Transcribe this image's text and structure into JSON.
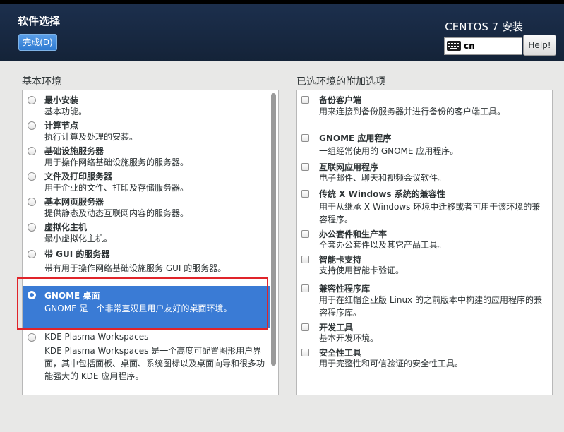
{
  "header": {
    "title": "软件选择",
    "done_button": "完成(D)",
    "install_title": "CENTOS 7 安装",
    "keyboard_layout": "cn",
    "help_button": "Help!"
  },
  "base_env": {
    "heading": "基本环境",
    "items": [
      {
        "name": "最小安装",
        "desc": "基本功能。"
      },
      {
        "name": "计算节点",
        "desc": "执行计算及处理的安装。"
      },
      {
        "name": "基础设施服务器",
        "desc": "用于操作网络基础设施服务的服务器。"
      },
      {
        "name": "文件及打印服务器",
        "desc": "用于企业的文件、打印及存储服务器。"
      },
      {
        "name": "基本网页服务器",
        "desc": "提供静态及动态互联网内容的服务器。"
      },
      {
        "name": "虚拟化主机",
        "desc": "最小虚拟化主机。"
      },
      {
        "name": "带 GUI 的服务器",
        "desc": "带有用于操作网络基础设施服务 GUI 的服务器。"
      },
      {
        "name": "GNOME 桌面",
        "desc": "GNOME 是一个非常直观且用户友好的桌面环境。",
        "selected": true
      },
      {
        "name": "KDE Plasma Workspaces",
        "desc": "KDE Plasma Workspaces 是一个高度可配置图形用户界面，其中包括面板、桌面、系统图标以及桌面向导和很多功能强大的 KDE 应用程序。"
      }
    ]
  },
  "addons": {
    "heading": "已选环境的附加选项",
    "items": [
      {
        "name": "备份客户端",
        "desc": "用来连接到备份服务器并进行备份的客户端工具。"
      },
      {
        "name": "GNOME 应用程序",
        "desc": "一组经常使用的 GNOME 应用程序。"
      },
      {
        "name": "互联网应用程序",
        "desc": "电子邮件、聊天和视频会议软件。"
      },
      {
        "name": "传统 X Windows 系统的兼容性",
        "desc": "用于从继承 X Windows 环境中迁移或者可用于该环境的兼容程序。"
      },
      {
        "name": "办公套件和生产率",
        "desc": "全套办公套件以及其它产品工具。"
      },
      {
        "name": "智能卡支持",
        "desc": "支持使用智能卡验证。"
      },
      {
        "name": "兼容性程序库",
        "desc": "用于在红帽企业版 Linux 的之前版本中构建的应用程序的兼容程序库。"
      },
      {
        "name": "开发工具",
        "desc": "基本开发环境。"
      },
      {
        "name": "安全性工具",
        "desc": "用于完整性和可信验证的安全性工具。"
      }
    ]
  }
}
